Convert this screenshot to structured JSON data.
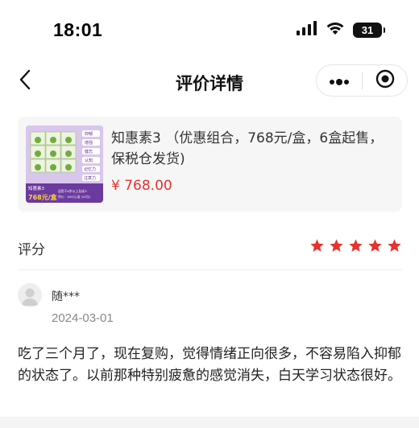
{
  "status_bar": {
    "time": "18:01",
    "battery": "31",
    "icons": [
      "signal-icon",
      "wifi-icon",
      "battery-icon"
    ]
  },
  "nav": {
    "title": "评价详情",
    "icons": [
      "back-chevron-icon",
      "more-dots-icon",
      "miniprogram-close-icon"
    ]
  },
  "product": {
    "name": "知惠素3 （优惠组合，768元/盒，6盒起售，保税仓发货)",
    "price": "¥ 768.00",
    "thumb": {
      "side_labels": [
        "抑郁",
        "增强",
        "健忘",
        "认知",
        "记忆力",
        "注意力"
      ],
      "brand": "知惠素3",
      "price_tag": "768元/盒",
      "caption_1": "适用于6岁以上及成人",
      "caption_2": "原价：868元/盒 (60包)"
    }
  },
  "rating": {
    "label": "评分",
    "stars": 5,
    "max_stars": 5,
    "star_color": "#e8322d"
  },
  "review": {
    "user": "随***",
    "date": "2024-03-01",
    "text": "吃了三个月了，现在复购，觉得情绪正向很多，不容易陷入抑郁的状态了。以前那种特别疲惫的感觉消失，白天学习状态很好。"
  }
}
